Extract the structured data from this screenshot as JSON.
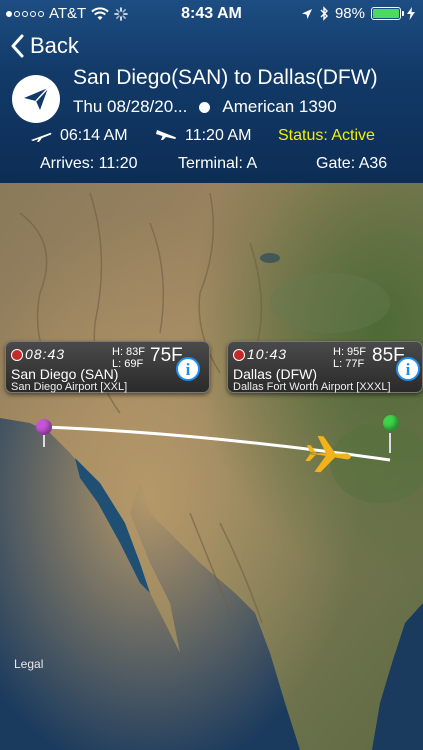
{
  "statusbar": {
    "carrier": "AT&T",
    "time": "8:43 AM",
    "battery": "98%",
    "battery_level": 0.98
  },
  "nav": {
    "back_label": "Back"
  },
  "flight": {
    "route": "San Diego(SAN) to Dallas(DFW)",
    "date": "Thu 08/28/20...",
    "airline_flight": "American 1390",
    "depart_time": "06:14 AM",
    "arrive_time": "11:20 AM",
    "status": "Status: Active",
    "arrives": "Arrives: 11:20",
    "terminal": "Terminal: A",
    "gate": "Gate: A36"
  },
  "map": {
    "legal": "Legal",
    "origin": {
      "local_time": "08:43",
      "high": "H: 83F",
      "low": "L: 69F",
      "temp": "75F",
      "city": "San Diego (SAN)",
      "airport": "San Diego Airport [XXL]"
    },
    "destination": {
      "local_time": "10:43",
      "high": "H: 95F",
      "low": "L: 77F",
      "temp": "85F",
      "city": "Dallas (DFW)",
      "airport": "Dallas Fort Worth Airport [XXXL]"
    }
  },
  "colors": {
    "status_active": "#f2f200",
    "info_button": "#1e8ff0",
    "origin_pin": "#c455d8",
    "destination_pin": "#3fd34a",
    "plane": "#f2b21a"
  }
}
